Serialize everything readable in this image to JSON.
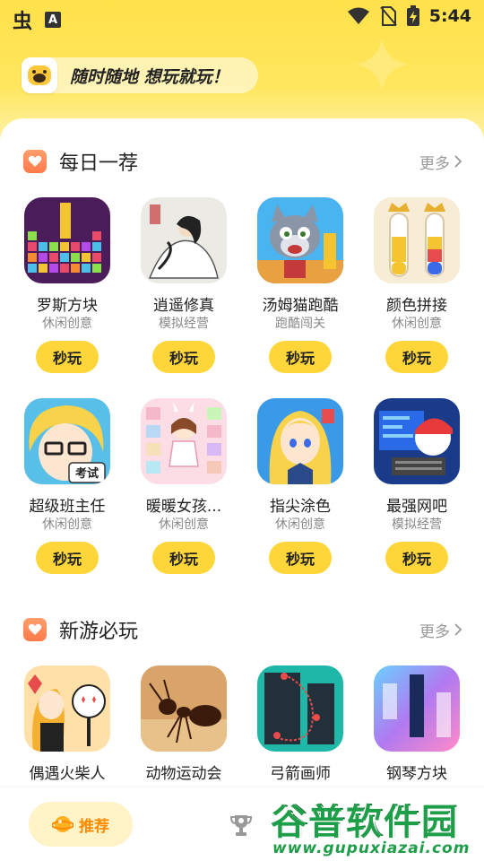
{
  "status_bar": {
    "time": "5:44",
    "carrier_logo": "虫",
    "notification_letter": "A"
  },
  "header": {
    "slogan": "随时随地 想玩就玩！"
  },
  "sections": [
    {
      "title": "每日一荐",
      "more": "更多",
      "games": [
        {
          "name": "罗斯方块",
          "category": "休闲创意",
          "play": "秒玩"
        },
        {
          "name": "逍遥修真",
          "category": "模拟经营",
          "play": "秒玩"
        },
        {
          "name": "汤姆猫跑酷",
          "category": "跑酷闯关",
          "play": "秒玩"
        },
        {
          "name": "颜色拼接",
          "category": "休闲创意",
          "play": "秒玩"
        },
        {
          "name": "超级班主任",
          "category": "休闲创意",
          "play": "秒玩",
          "icon_text": "考试"
        },
        {
          "name": "暖暖女孩...",
          "category": "休闲创意",
          "play": "秒玩"
        },
        {
          "name": "指尖涂色",
          "category": "休闲创意",
          "play": "秒玩"
        },
        {
          "name": "最强网吧",
          "category": "模拟经营",
          "play": "秒玩"
        }
      ]
    },
    {
      "title": "新游必玩",
      "more": "更多",
      "games": [
        {
          "name": "偶遇火柴人"
        },
        {
          "name": "动物运动会"
        },
        {
          "name": "弓箭画师"
        },
        {
          "name": "钢琴方块"
        }
      ]
    }
  ],
  "bottom_nav": {
    "recommend_label": "推荐"
  },
  "watermark": {
    "title": "谷普软件园",
    "url": "www.gupuxiazai.com"
  },
  "colors": {
    "accent_yellow": "#ffd63a",
    "section_icon": "#ff8a55",
    "nav_active": "#ff8a00"
  }
}
